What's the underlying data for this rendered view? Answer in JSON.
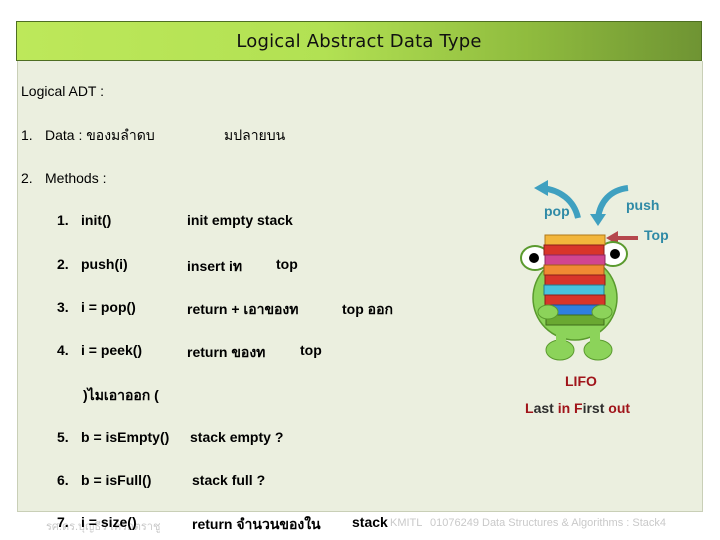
{
  "header": {
    "title": "Logical Abstract Data Type"
  },
  "body": {
    "heading": "Logical ADT :",
    "data_item": {
      "number": "1.",
      "label": "Data : ของมลำดบ",
      "trail": "มปลายบน"
    },
    "methods_item": {
      "number": "2.",
      "label": "Methods :"
    },
    "methods": [
      {
        "number": "1.",
        "signature": "init()",
        "description": "init empty stack",
        "extra": ""
      },
      {
        "number": "2.",
        "signature": "push(i)",
        "description": "insert iท",
        "extra": "top"
      },
      {
        "number": "3.",
        "signature": "i = pop()",
        "description": "return + เอาของท",
        "extra": "top  ออก"
      },
      {
        "number": "4.",
        "signature": "i = peek()",
        "description": "return ของท",
        "extra": "top"
      },
      {
        "number": "",
        "signature": ")ไมเอาออก  (",
        "description": "",
        "extra": ""
      },
      {
        "number": "5.",
        "signature": "b = isEmpty()",
        "description": "stack empty ?",
        "extra": ""
      },
      {
        "number": "6.",
        "signature": "b = isFull()",
        "description": "stack full ?",
        "extra": ""
      },
      {
        "number": "7.",
        "signature": "i = size()",
        "description": "return จำนวนของใน",
        "extra": "stack"
      }
    ]
  },
  "illustration": {
    "pop_label": "pop",
    "push_label": "push",
    "top_label": "Top",
    "lifo_title": "LIFO",
    "lifo_parts": [
      {
        "text": "L",
        "accent": true
      },
      {
        "text": "ast ",
        "accent": false
      },
      {
        "text": "in",
        "accent": true
      },
      {
        "text": " ",
        "accent": false
      },
      {
        "text": "F",
        "accent": true
      },
      {
        "text": "irst ",
        "accent": false
      },
      {
        "text": "out",
        "accent": true
      }
    ],
    "colors": {
      "arrow": "#3fa0c0",
      "top_arrow": "#b5474d",
      "accent": "#a0141a",
      "body": "#8cd35a"
    }
  },
  "footer": {
    "authors_watermark": "รศ.ดร.บุญธีร์ เครือตราชู",
    "institution": "KMITL",
    "course": "01076249 Data Structures & Algorithms : Stack4"
  }
}
